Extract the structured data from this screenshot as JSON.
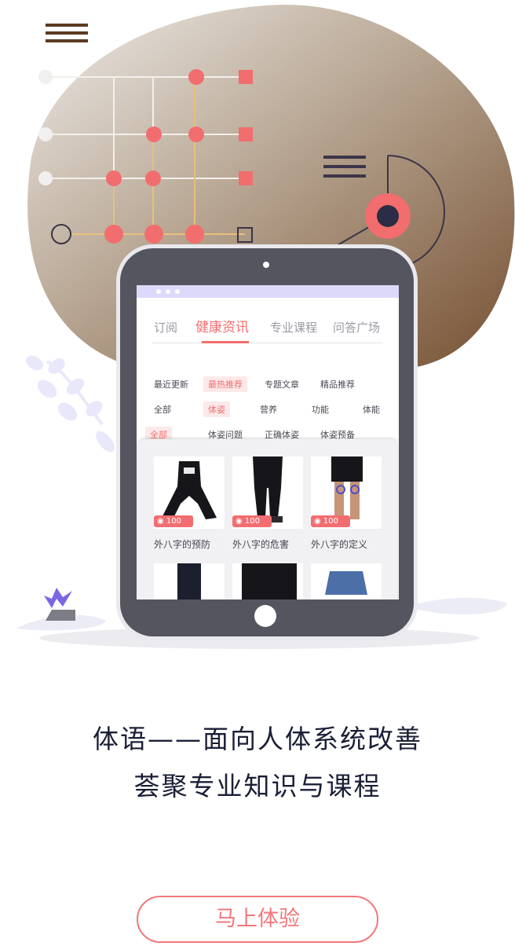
{
  "tablet": {
    "tabs": [
      "订阅",
      "健康资讯",
      "专业课程",
      "问答广场"
    ],
    "active_tab": "健康资讯",
    "filter_rows": [
      [
        "最近更新",
        "最热推荐",
        "专题文章",
        "精品推荐"
      ],
      [
        "全部",
        "体姿",
        "营养",
        "功能",
        "体能"
      ],
      [
        "全部",
        "体姿问题",
        "正确体姿",
        "体姿预备"
      ]
    ],
    "cards": [
      {
        "title": "外八字的预防",
        "views": "100"
      },
      {
        "title": "外八字的危害",
        "views": "100"
      },
      {
        "title": "外八字的定义",
        "views": "100"
      }
    ]
  },
  "headline": {
    "line1": "体语——面向人体系统改善",
    "line2": "荟聚专业知识与课程"
  },
  "cta": {
    "label": "马上体验"
  },
  "colors": {
    "accent": "#f16f70",
    "tablet": "#54555f",
    "title": "#1a1f36",
    "blob_light": "#e7e3df",
    "blob_dark": "#7b5532"
  },
  "icons": [
    "menu-icon",
    "grid-network-illustration",
    "leaf-decoration",
    "target-icon",
    "eye-icon",
    "camera-dot",
    "home-button"
  ]
}
